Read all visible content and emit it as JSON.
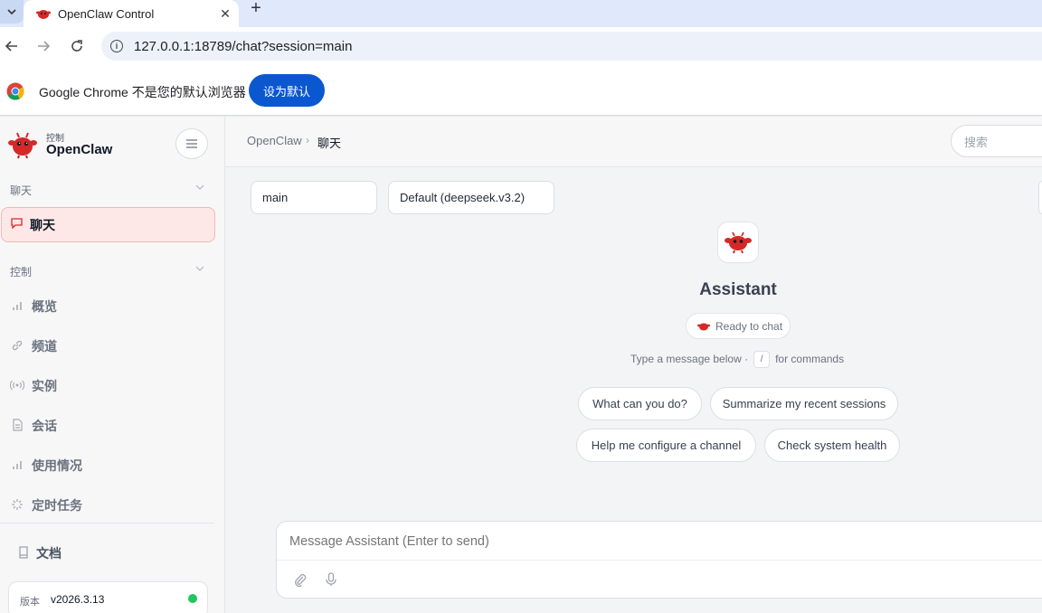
{
  "browser": {
    "tab_title": "OpenClaw Control",
    "tab_close": "✕",
    "new_tab": "+",
    "url": "127.0.0.1:18789/chat?session=main",
    "infobar_text": "Google Chrome 不是您的默认浏览器",
    "infobar_button": "设为默认"
  },
  "sidebar": {
    "brand_sub": "控制",
    "brand_name": "OpenClaw",
    "toggle_icon": "hamburger-icon",
    "sections": [
      {
        "label": "聊天"
      },
      {
        "label": "控制"
      }
    ],
    "active_item": {
      "label": "聊天",
      "icon": "chat-icon"
    },
    "items": [
      {
        "label": "概览",
        "icon": "bar-chart-icon"
      },
      {
        "label": "频道",
        "icon": "link-icon"
      },
      {
        "label": "实例",
        "icon": "broadcast-icon"
      },
      {
        "label": "会话",
        "icon": "document-icon"
      },
      {
        "label": "使用情况",
        "icon": "bar-chart-icon"
      },
      {
        "label": "定时任务",
        "icon": "spinner-icon"
      }
    ],
    "docs": {
      "label": "文档",
      "icon": "book-icon"
    },
    "version": {
      "key": "版本",
      "value": "v2026.3.13",
      "status_color": "#22c55e"
    }
  },
  "topbar": {
    "breadcrumb_root": "OpenClaw",
    "breadcrumb_sep": "›",
    "breadcrumb_current": "聊天",
    "search_placeholder": "搜索"
  },
  "chat": {
    "session_select": "main",
    "model_select": "Default (deepseek.v3.2)",
    "assistant_name": "Assistant",
    "status": "Ready to chat",
    "hint_prefix": "Type a message below ·",
    "hint_key": "/",
    "hint_suffix": "for commands",
    "suggestions": [
      "What can you do?",
      "Summarize my recent sessions",
      "Help me configure a channel",
      "Check system health"
    ],
    "composer_placeholder": "Message Assistant (Enter to send)"
  },
  "colors": {
    "accent": "#dc2626",
    "chrome_blue": "#0b57d0",
    "active_bg": "#fde8e7"
  }
}
